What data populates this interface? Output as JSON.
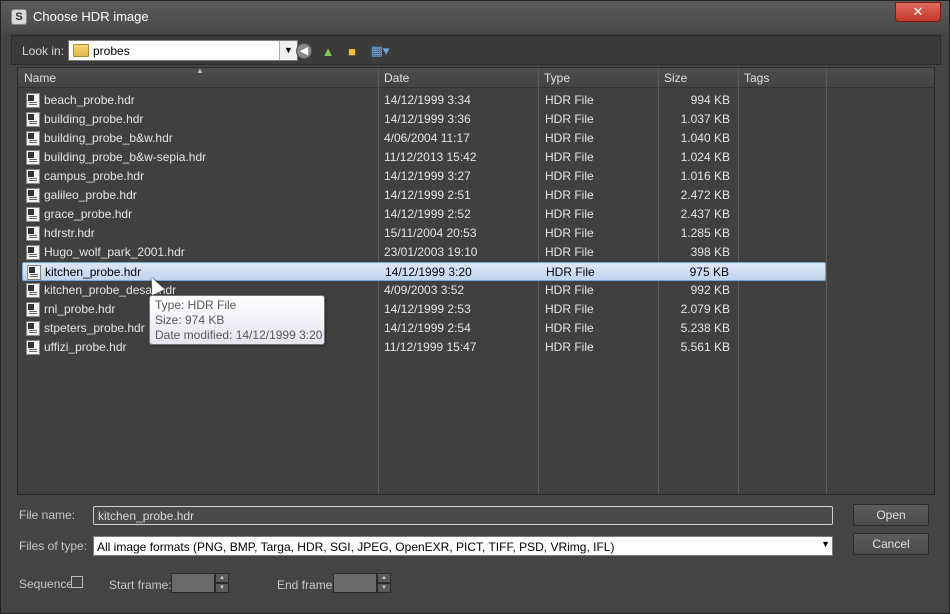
{
  "window": {
    "title": "Choose HDR image",
    "close_label": "✕"
  },
  "toolbar": {
    "lookin_label": "Look in:",
    "lookin_value": "probes",
    "icons": [
      "back-icon",
      "up-folder-icon",
      "new-folder-icon",
      "views-menu-icon"
    ]
  },
  "columns": {
    "name": "Name",
    "date": "Date",
    "type": "Type",
    "size": "Size",
    "tags": "Tags"
  },
  "files": [
    {
      "name": "beach_probe.hdr",
      "date": "14/12/1999 3:34",
      "type": "HDR File",
      "size": "994 KB"
    },
    {
      "name": "building_probe.hdr",
      "date": "14/12/1999 3:36",
      "type": "HDR File",
      "size": "1.037 KB"
    },
    {
      "name": "building_probe_b&w.hdr",
      "date": "4/06/2004 11:17",
      "type": "HDR File",
      "size": "1.040 KB"
    },
    {
      "name": "building_probe_b&w-sepia.hdr",
      "date": "11/12/2013 15:42",
      "type": "HDR File",
      "size": "1.024 KB"
    },
    {
      "name": "campus_probe.hdr",
      "date": "14/12/1999 3:27",
      "type": "HDR File",
      "size": "1.016 KB"
    },
    {
      "name": "galileo_probe.hdr",
      "date": "14/12/1999 2:51",
      "type": "HDR File",
      "size": "2.472 KB"
    },
    {
      "name": "grace_probe.hdr",
      "date": "14/12/1999 2:52",
      "type": "HDR File",
      "size": "2.437 KB"
    },
    {
      "name": "hdrstr.hdr",
      "date": "15/11/2004 20:53",
      "type": "HDR File",
      "size": "1.285 KB"
    },
    {
      "name": "Hugo_wolf_park_2001.hdr",
      "date": "23/01/2003 19:10",
      "type": "HDR File",
      "size": "398 KB"
    },
    {
      "name": "kitchen_probe.hdr",
      "date": "14/12/1999 3:20",
      "type": "HDR File",
      "size": "975 KB"
    },
    {
      "name": "kitchen_probe_desat.hdr",
      "date": "4/09/2003 3:52",
      "type": "HDR File",
      "size": "992 KB"
    },
    {
      "name": "rnl_probe.hdr",
      "date": "14/12/1999 2:53",
      "type": "HDR File",
      "size": "2.079 KB"
    },
    {
      "name": "stpeters_probe.hdr",
      "date": "14/12/1999 2:54",
      "type": "HDR File",
      "size": "5.238 KB"
    },
    {
      "name": "uffizi_probe.hdr",
      "date": "11/12/1999 15:47",
      "type": "HDR File",
      "size": "5.561 KB"
    }
  ],
  "selected_index": 9,
  "tooltip": {
    "type_line": "Type: HDR File",
    "size_line": "Size: 974 KB",
    "date_line": "Date modified: 14/12/1999 3:20"
  },
  "form": {
    "filename_label": "File name:",
    "filename_value": "kitchen_probe.hdr",
    "filetype_label": "Files of type:",
    "filetype_value": "All image formats (PNG, BMP, Targa, HDR, SGI, JPEG, OpenEXR, PICT, TIFF, PSD, VRimg, IFL)",
    "open_label": "Open",
    "cancel_label": "Cancel",
    "sequence_label": "Sequence",
    "start_frame_label": "Start frame:",
    "end_frame_label": "End frame:"
  },
  "colors": {
    "accent_selection": "#c1d5ef",
    "close_button": "#c0392b",
    "background": "#444444"
  }
}
